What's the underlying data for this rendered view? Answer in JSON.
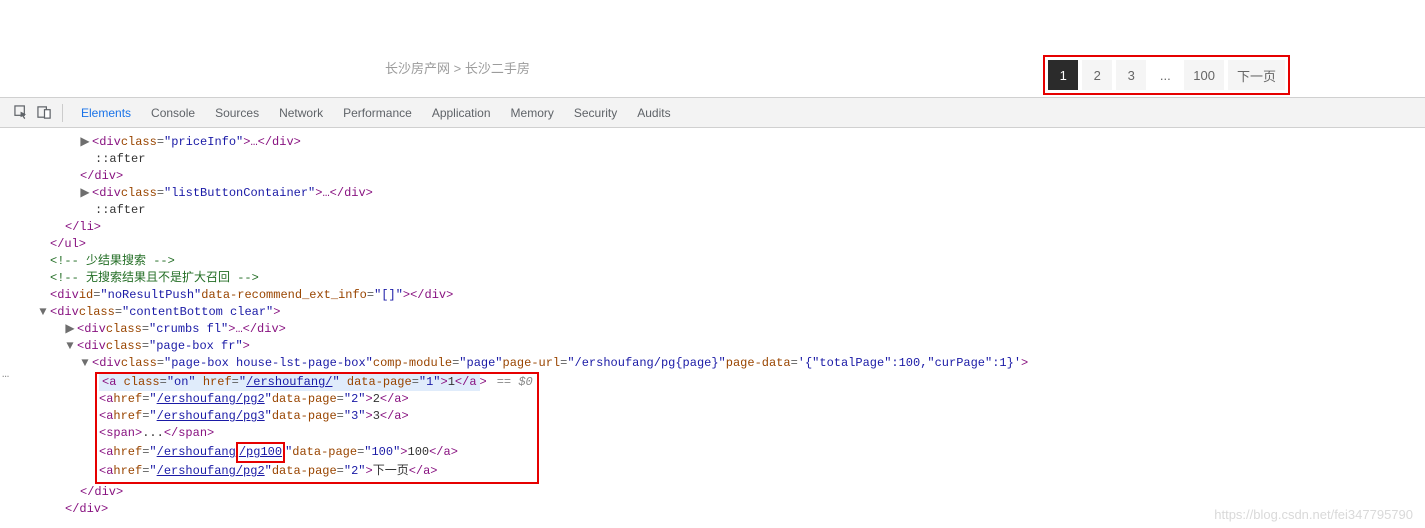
{
  "breadcrumb": {
    "site": "长沙房产网",
    "sep": ">",
    "section": "长沙二手房"
  },
  "pagination": {
    "p1": "1",
    "p2": "2",
    "p3": "3",
    "ell": "...",
    "p100": "100",
    "next": "下一页"
  },
  "devtools": {
    "tabs": {
      "elements": "Elements",
      "console": "Console",
      "sources": "Sources",
      "network": "Network",
      "performance": "Performance",
      "application": "Application",
      "memory": "Memory",
      "security": "Security",
      "audits": "Audits"
    }
  },
  "code": {
    "div_price": {
      "tag_o": "<div ",
      "cls_k": "class",
      "cls_v": "\"priceInfo\"",
      "mid": ">…</div>",
      "close": ""
    },
    "after": "::after",
    "cdiv": "</div>",
    "list_btn": {
      "tag_o": "<div ",
      "cls_k": "class",
      "cls_v": "\"listButtonContainer\"",
      "mid": ">…</div>"
    },
    "cli": "</li>",
    "cul": "</ul>",
    "cmt1": "<!-- 少结果搜索 -->",
    "cmt2": "<!-- 无搜索结果且不是扩大召回 -->",
    "noresult": {
      "tag_o": "<div ",
      "id_k": "id",
      "id_v": "\"noResultPush\"",
      "d_k": "data-recommend_ext_info",
      "d_v": "\"[]\"",
      "tail": "></div>"
    },
    "content_btm": {
      "tag_o": "<div ",
      "cls_k": "class",
      "cls_v": "\"contentBottom clear\"",
      "tail": ">"
    },
    "crumbs": {
      "tag_o": "<div ",
      "cls_k": "class",
      "cls_v": "\"crumbs fl\"",
      "tail": ">…</div>"
    },
    "pbox": {
      "tag_o": "<div ",
      "cls_k": "class",
      "cls_v": "\"page-box fr\"",
      "tail": ">"
    },
    "pbox2": {
      "tag_o": "<div ",
      "cls_k": "class",
      "cls_v": "\"page-box house-lst-page-box\"",
      "cm_k": "comp-module",
      "cm_v": "\"page\"",
      "pu_k": "page-url",
      "pu_v": "\"/ershoufang/pg{page}\"",
      "pd_k": "page-data",
      "pd_v": "'{\"totalPage\":100,\"curPage\":1}'",
      "tail": ">"
    },
    "a1": {
      "tag_o": "<a ",
      "cls_k": "class",
      "cls_v": "\"on\"",
      "h_k": "href",
      "h_pre": "\"",
      "h_link": "/ershoufang/",
      "h_post": "\"",
      "dp_k": "data-page",
      "dp_v": "\"1\"",
      "txt": "1",
      "close_a": "</a",
      "close_b": ">"
    },
    "a2": {
      "tag_o": "<a ",
      "h_k": "href",
      "h_pre": "\"",
      "h_link": "/ershoufang/pg2",
      "h_post": "\"",
      "dp_k": "data-page",
      "dp_v": "\"2\"",
      "txt": "2",
      "close": "</a>"
    },
    "a3": {
      "tag_o": "<a ",
      "h_k": "href",
      "h_pre": "\"",
      "h_link": "/ershoufang/pg3",
      "h_post": "\"",
      "dp_k": "data-page",
      "dp_v": "\"3\"",
      "txt": "3",
      "close": "</a>"
    },
    "span": {
      "open": "<span>",
      "txt": "...",
      "close": "</span>"
    },
    "a100": {
      "tag_o": "<a ",
      "h_k": "href",
      "h_pre": "\"",
      "h_link_a": "/ershoufang",
      "h_link_b": "/pg100",
      "h_post": "\"",
      "dp_k": "data-page",
      "dp_v": "\"100\"",
      "txt": "100",
      "close": "</a>"
    },
    "anext": {
      "tag_o": "<a ",
      "h_k": "href",
      "h_pre": "\"",
      "h_link": "/ershoufang/pg2",
      "h_post": "\"",
      "dp_k": "data-page",
      "dp_v": "\"2\"",
      "txt": "下一页",
      "close": "</a>"
    },
    "cdiv2": "</div>",
    "eqdollar": "== $0",
    "gutter_dots": "…"
  },
  "watermark": "https://blog.csdn.net/fei347795790"
}
